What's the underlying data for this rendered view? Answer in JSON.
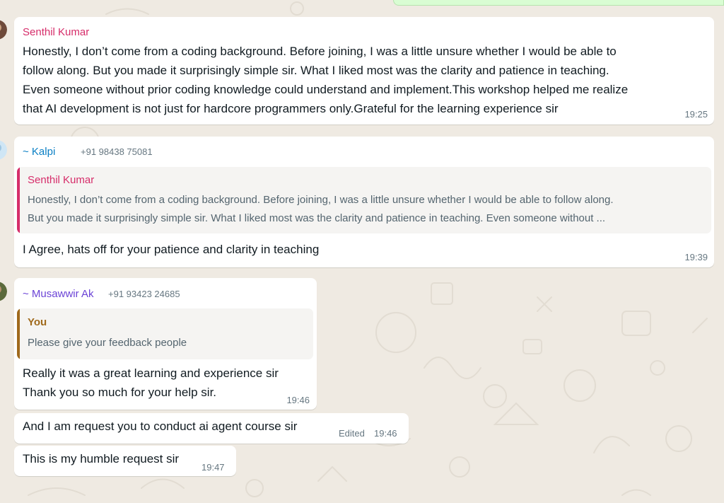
{
  "colors": {
    "chat_bg": "#efeae2",
    "bubble_bg": "#ffffff",
    "outgoing_bg": "#d9fdd3",
    "senthil": "#d62d6a",
    "kalpi": "#0a7fc4",
    "musawwir": "#6b43d6",
    "you_quote": "#a06a1c",
    "meta_text": "#667781"
  },
  "messages": [
    {
      "sender": "Senthil Kumar",
      "text": "Honestly, I don’t come from a coding background. Before joining, I was a little unsure whether I would be able to\nfollow along. But you made it surprisingly simple sir. What I liked most was the clarity and patience in teaching.\nEven someone without prior coding knowledge could understand and implement.This workshop helped me realize\nthat AI development is not just for hardcore programmers only.Grateful for the learning experience sir",
      "time": "19:25"
    },
    {
      "sender": "~ Kalpi",
      "phone": "+91 98438 75081",
      "quote": {
        "name": "Senthil Kumar",
        "text": "Honestly, I don’t come from a coding background. Before joining, I was a little unsure whether I would be able to follow along.\nBut you made it surprisingly simple sir. What I liked most was the clarity and patience in teaching. Even someone without ..."
      },
      "text": "I Agree, hats off for your patience and clarity in teaching",
      "time": "19:39"
    },
    {
      "sender": "~ Musawwir Ak",
      "phone": "+91 93423 24685",
      "quote": {
        "name": "You",
        "text": "Please give your feedback people"
      },
      "text": "Really it was a  great learning and experience sir\nThank you so much for your help sir.",
      "time": "19:46"
    },
    {
      "text": "And I am request  you to  conduct ai agent course sir",
      "edited": "Edited",
      "time": "19:46"
    },
    {
      "text": "This is my humble request sir",
      "time": "19:47"
    }
  ]
}
